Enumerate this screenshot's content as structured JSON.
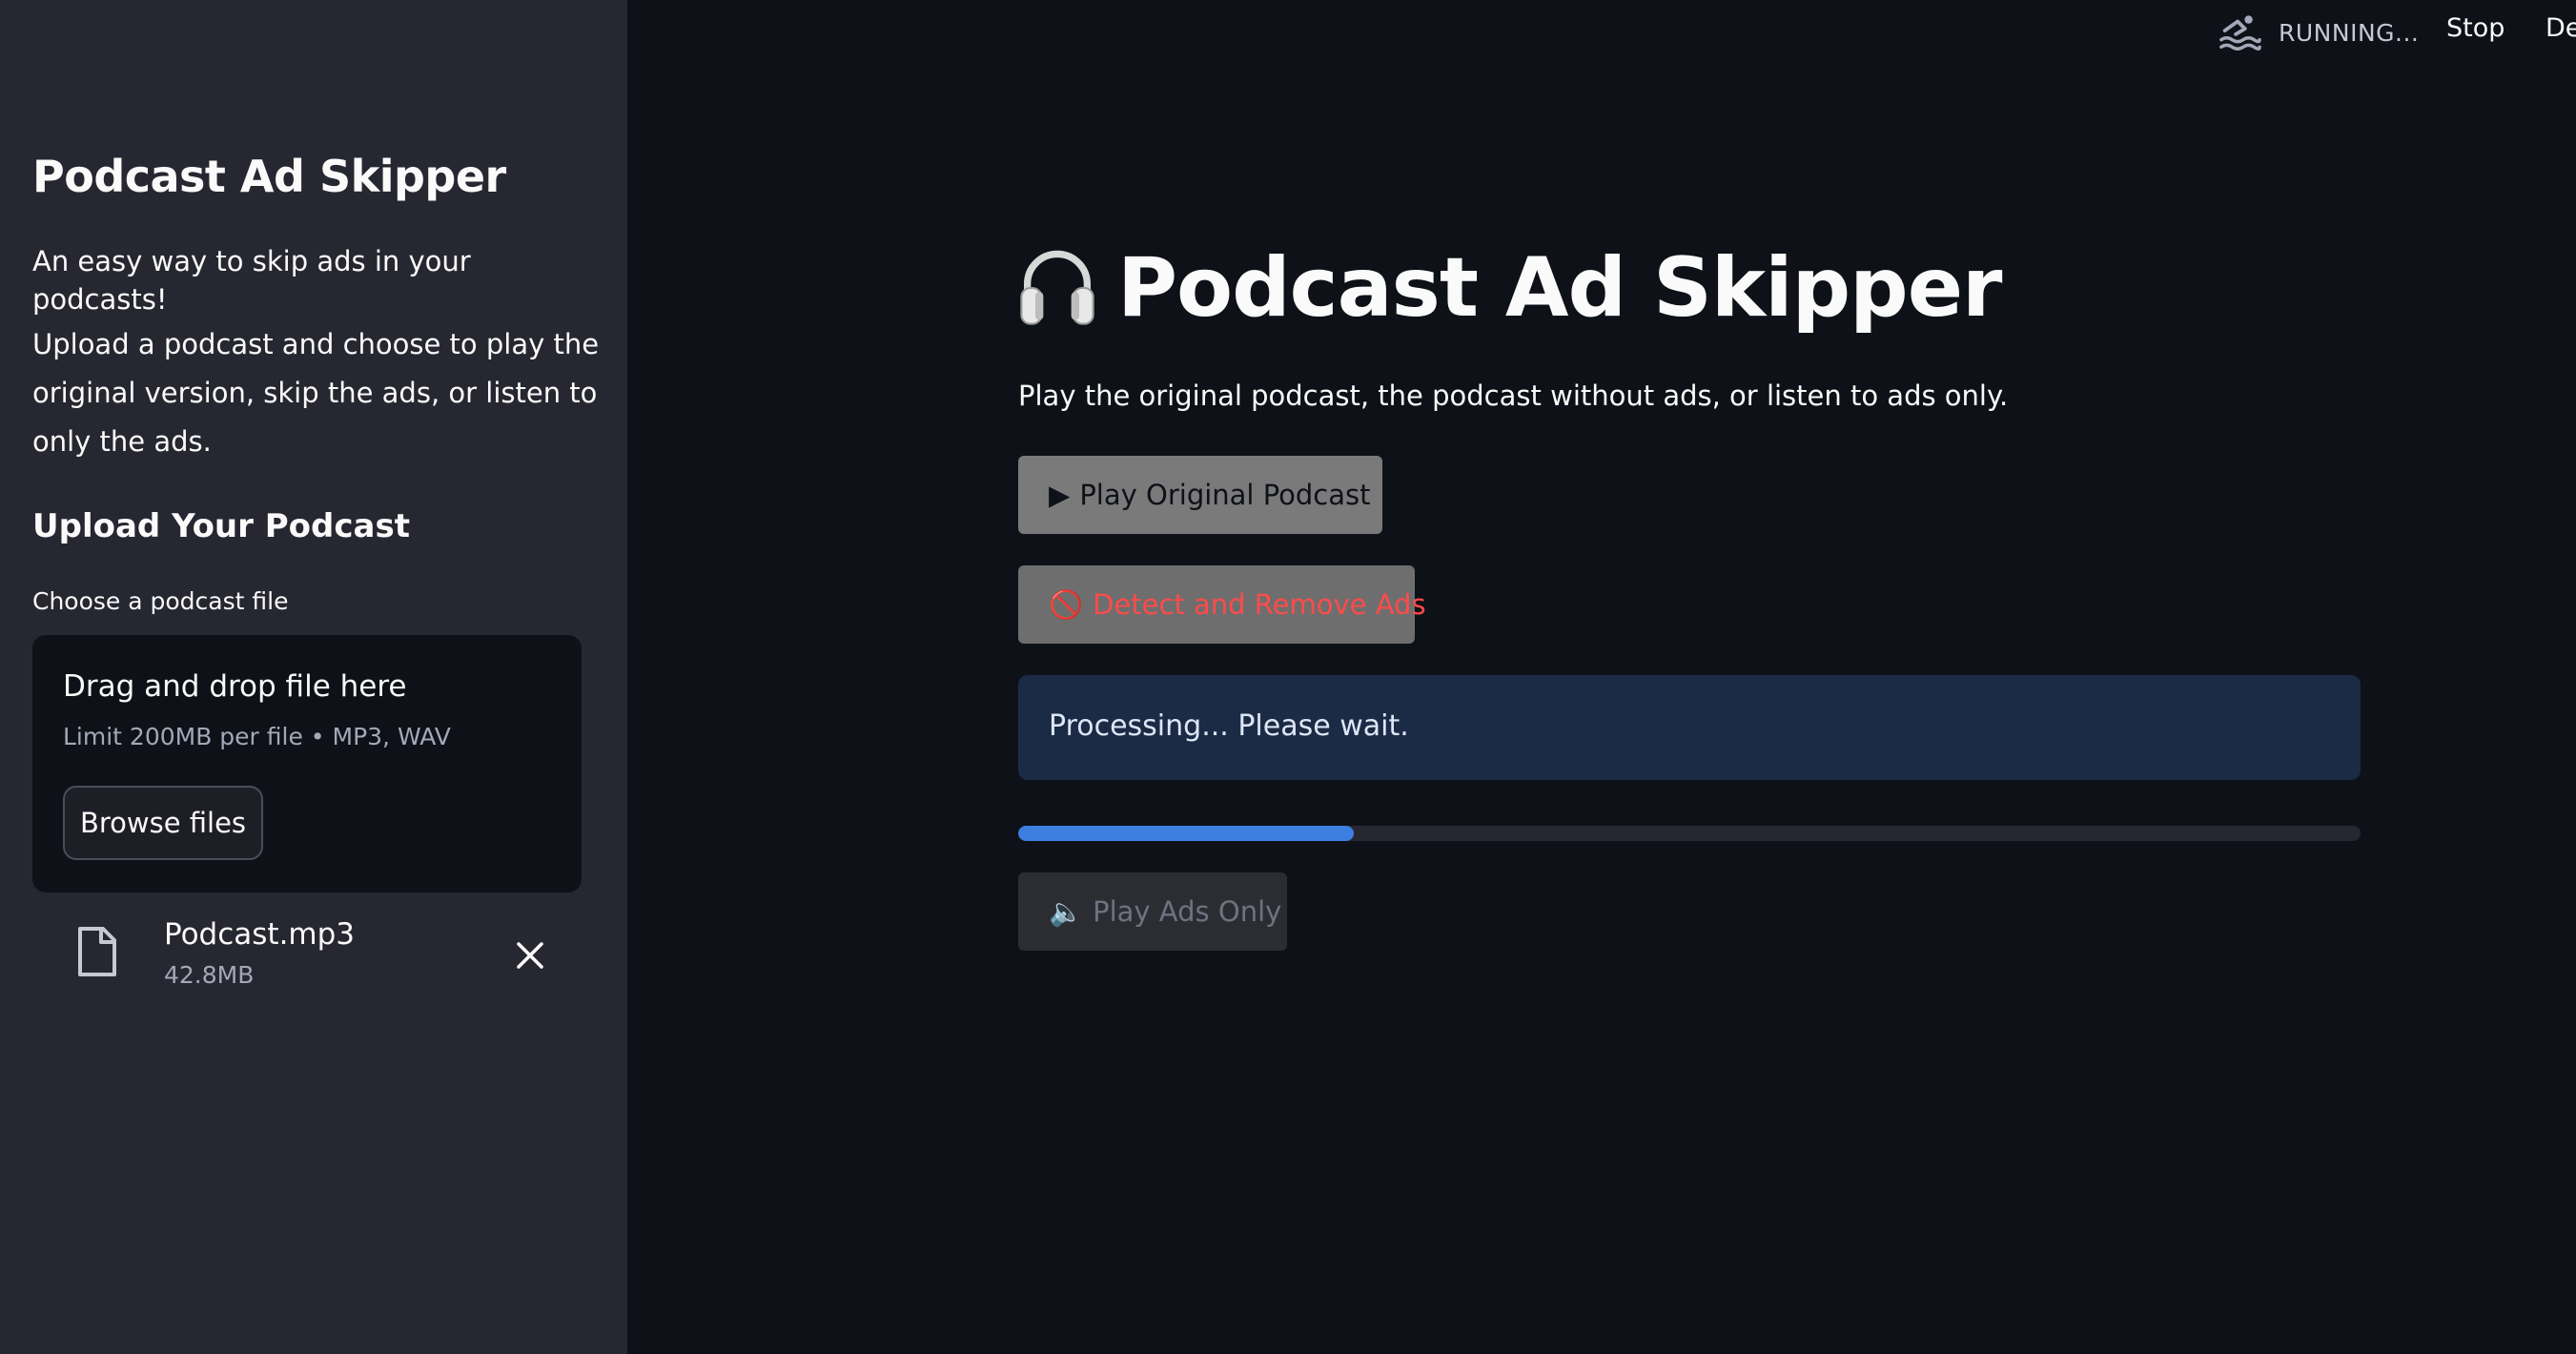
{
  "sidebar": {
    "title": "Podcast Ad Skipper",
    "tagline": "An easy way to skip ads in your podcasts!",
    "description": "Upload a podcast and choose to play the original version, skip the ads, or listen to only the ads.",
    "upload_heading": "Upload Your Podcast",
    "file_label": "Choose a podcast file",
    "dropzone": {
      "title": "Drag and drop file here",
      "limit": "Limit 200MB per file • MP3, WAV",
      "browse_label": "Browse files"
    },
    "file": {
      "name": "Podcast.mp3",
      "size": "42.8MB"
    }
  },
  "topbar": {
    "status": "RUNNING...",
    "stop_label": "Stop",
    "deploy_label": "De"
  },
  "main": {
    "title": "Podcast Ad Skipper",
    "description": "Play the original podcast, the podcast without ads, or listen to ads only.",
    "buttons": {
      "play_original": {
        "icon": "▶",
        "label": "Play Original Podcast"
      },
      "detect_remove": {
        "icon": "🚫",
        "label": "Detect and Remove Ads"
      },
      "play_ads": {
        "icon": "🔈",
        "label": "Play Ads Only"
      }
    },
    "info": "Processing... Please wait.",
    "progress": 0.25
  },
  "colors": {
    "background": "#0e1117",
    "sidebar": "#262730",
    "info_bg": "#1c2b45",
    "progress": "#3d7fe0",
    "detect_text": "#ff4b4b"
  }
}
